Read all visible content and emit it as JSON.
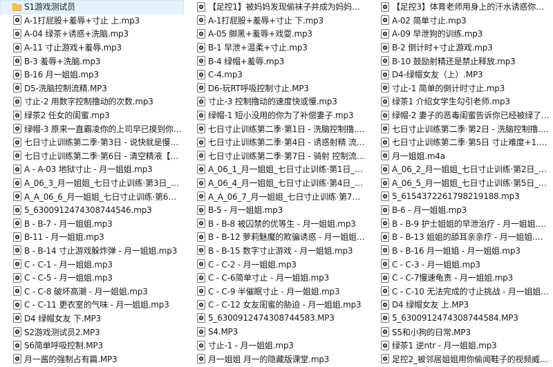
{
  "colors": {
    "selection": "#e5f3ff",
    "folder": "#f2c14e",
    "audio_icon_border": "#6b6b6b"
  },
  "files": [
    {
      "name": "S1游戏测试员",
      "type": "folder"
    },
    {
      "name": "A-1打屁股+羞辱+寸止 上.mp3",
      "type": "audio"
    },
    {
      "name": "A-04 绿茶+诱惑+洗脑.mp3",
      "type": "audio"
    },
    {
      "name": "A-11 寸止游戏+羞辱.mp3",
      "type": "audio"
    },
    {
      "name": "B-3 羞辱+洗脑.mp3",
      "type": "audio"
    },
    {
      "name": "B-16 月一姐姐.mp3",
      "type": "audio"
    },
    {
      "name": "D5-洗脑控制流精.MP3",
      "type": "audio"
    },
    {
      "name": "寸止-2 用数字控制撸动的次数.mp3",
      "type": "audio"
    },
    {
      "name": "绿茶2 任女的闺蜜.mp3",
      "type": "audio"
    },
    {
      "name": "绿帽-3 原来一直霸凌你的上司早已摸到你的老婆...",
      "type": "audio"
    },
    {
      "name": "七日寸止训练第二季·第3日 - 说快就是慢慢撸 ...",
      "type": "audio"
    },
    {
      "name": "七日寸止训练第二季·第6日 - 清空精液【流精...",
      "type": "audio"
    },
    {
      "name": "A - A-03 地狱寸止 - 月一姐姐.mp3",
      "type": "audio"
    },
    {
      "name": "A_06_3_月一姐姐_七日寸止训练·第3日_月一姐...",
      "type": "audio"
    },
    {
      "name": "A_A_06_6_月一姐姐_七日寸止训练·第6日_月一...",
      "type": "audio"
    },
    {
      "name": "5_6300912474308744546.mp3",
      "type": "audio"
    },
    {
      "name": "B - B-7 - 月一姐姐.mp3",
      "type": "audio"
    },
    {
      "name": "B-11 - 月一姐姐.mp3",
      "type": "audio"
    },
    {
      "name": "B - B-14 寸止游戏躲炸弹 - 月一姐姐.mp3",
      "type": "audio"
    },
    {
      "name": "C - C-1 - 月一姐姐.mp3",
      "type": "audio"
    },
    {
      "name": "C - C-5 - 月一姐姐.mp3",
      "type": "audio"
    },
    {
      "name": "C - C-8 破坏高潮 - 月一姐姐.mp3",
      "type": "audio"
    },
    {
      "name": "C - C-11 更衣室的气味 - 月一姐姐.mp3",
      "type": "audio"
    },
    {
      "name": "D4 绿帽女友 下.MP3",
      "type": "audio"
    },
    {
      "name": "S2游戏测试员2.MP3",
      "type": "audio"
    },
    {
      "name": "S6简单呼吸控制.MP3",
      "type": "audio"
    },
    {
      "name": "月一酱的强制占有篇.MP3",
      "type": "audio"
    },
    {
      "name": "【足控1】被妈妈发现偷袜子并成为妈妈的私有...",
      "type": "audio"
    },
    {
      "name": "A-1打屁股+羞辱+寸止 下.mp3",
      "type": "audio"
    },
    {
      "name": "A-05 脚黑+羞辱+戏耍.mp3",
      "type": "audio"
    },
    {
      "name": "B-1 早泄+温柔+寸止.mp3",
      "type": "audio"
    },
    {
      "name": "B-4 绿帽+羞辱.mp3",
      "type": "audio"
    },
    {
      "name": "C-4.mp3",
      "type": "audio"
    },
    {
      "name": "D6-玩RT呼吸控制寸止.MP3",
      "type": "audio"
    },
    {
      "name": "寸止-3 控制撸动的速度快或慢.mp3",
      "type": "audio"
    },
    {
      "name": "绿帽-1 短小没用的你为了补偿妻子.mp3",
      "type": "audio"
    },
    {
      "name": "七日寸止训练第二季·第1日 - 洗脑控制撸.mp3",
      "type": "audio"
    },
    {
      "name": "七日寸止训练第二季·第4日 - 诱惑射精 流精.m...",
      "type": "audio"
    },
    {
      "name": "七日寸止训练第二季·第7日 - 骑射 控制流精.m...",
      "type": "audio"
    },
    {
      "name": "A_06_1_月一姐姐_七日寸止训练·第1日_月一姐...",
      "type": "audio"
    },
    {
      "name": "A_06_4_月一姐姐_七日寸止训练·第4日_月一姐...",
      "type": "audio"
    },
    {
      "name": "A_A_06_7_月一姐姐_七日寸止训练·第7日_月一...",
      "type": "audio"
    },
    {
      "name": "B-5 - 月一姐姐.mp3",
      "type": "audio"
    },
    {
      "name": "B - B-8 被囚禁的优等生 - 月一姐姐.mp3",
      "type": "audio"
    },
    {
      "name": "B - B-12 萝莉魅魔的欺骗诱惑 - 月一姐姐.mp3",
      "type": "audio"
    },
    {
      "name": "B - B-15 数字寸止游戏 - 月一姐姐.mp3",
      "type": "audio"
    },
    {
      "name": "C - C-2 - 月一姐姐.mp3",
      "type": "audio"
    },
    {
      "name": "C - C-6简单寸止 - 月一姐姐.mp3",
      "type": "audio"
    },
    {
      "name": "C - C-9 半催眠寸止 - 月一姐姐.mp3",
      "type": "audio"
    },
    {
      "name": "C - C-12 女友闺蜜的胁迫 - 月一姐姐.mp3",
      "type": "audio"
    },
    {
      "name": "5_6300912474308744583.MP3",
      "type": "audio"
    },
    {
      "name": "S4.MP3",
      "type": "audio"
    },
    {
      "name": "寸止-1 - 月一姐姐.mp3",
      "type": "audio"
    },
    {
      "name": "月一姐姐 月一的隐藏版课堂.mp3",
      "type": "audio"
    },
    {
      "name": "【足控3】体育老师用身上的汗水诱惑你当狗...",
      "type": "audio"
    },
    {
      "name": "A-02 简单寸止.mp3",
      "type": "audio"
    },
    {
      "name": "A-09 早泄狗的训练.mp3",
      "type": "audio"
    },
    {
      "name": "B-2 倒计时+寸止游戏.mp3",
      "type": "audio"
    },
    {
      "name": "B-10 鼓励射精还是禁止释放.mp3",
      "type": "audio"
    },
    {
      "name": "D4-绿帽女友（上）.MP3",
      "type": "audio"
    },
    {
      "name": "寸止-1 简单的倒计时寸止.mp3",
      "type": "audio"
    },
    {
      "name": "绿茶1 介绍女学生勾引老师.mp3",
      "type": "audio"
    },
    {
      "name": "绿帽-2 妻子的恶毒闺蜜告诉你已经被绿了并羞...",
      "type": "audio"
    },
    {
      "name": "七日寸止训练第二季·第2日 - 洗脑控制撸.mp3",
      "type": "audio"
    },
    {
      "name": "七日寸止训练第二季·第5日 寸止难度+1.mp3",
      "type": "audio"
    },
    {
      "name": "月一姐姐.m4a",
      "type": "audio"
    },
    {
      "name": "A_06_2_月一姐姐_七日寸止训练·第2日_月一姐...",
      "type": "audio"
    },
    {
      "name": "A_06_5_月一姐姐_七日寸止训练·第5日_月一姐...",
      "type": "audio"
    },
    {
      "name": "5_6154372261798219188.mp3",
      "type": "audio"
    },
    {
      "name": "B-6 - 月一姐姐.mp3",
      "type": "audio"
    },
    {
      "name": "B - B-9 护士姐姐的早泄治疗 - 月一姐姐.mp3",
      "type": "audio"
    },
    {
      "name": "B - B-13 姐姐的舔耳亲亲疗 - 月一姐姐.mp3",
      "type": "audio"
    },
    {
      "name": "B - B-16 月一姐姐 - 月一姐姐.mp3",
      "type": "audio"
    },
    {
      "name": "C - C-3 - 月一姐姐.mp3",
      "type": "audio"
    },
    {
      "name": "C - C-7慢速龟责 - 月一姐姐.mp3",
      "type": "audio"
    },
    {
      "name": "C - C-10 无法完成的寸止挑战 - 月一姐姐.mp3",
      "type": "audio"
    },
    {
      "name": "D4 绿帽女友 上.MP3",
      "type": "audio"
    },
    {
      "name": "5_6300912474308744584.MP3",
      "type": "audio"
    },
    {
      "name": "S5和小狗的日常.MP3",
      "type": "audio"
    },
    {
      "name": "绿茶1 逆ntr - 月一姐姐.mp3",
      "type": "audio"
    },
    {
      "name": "足控2_被邻居姐姐用你偷闻鞋子的视频威胁当...",
      "type": "audio"
    }
  ]
}
